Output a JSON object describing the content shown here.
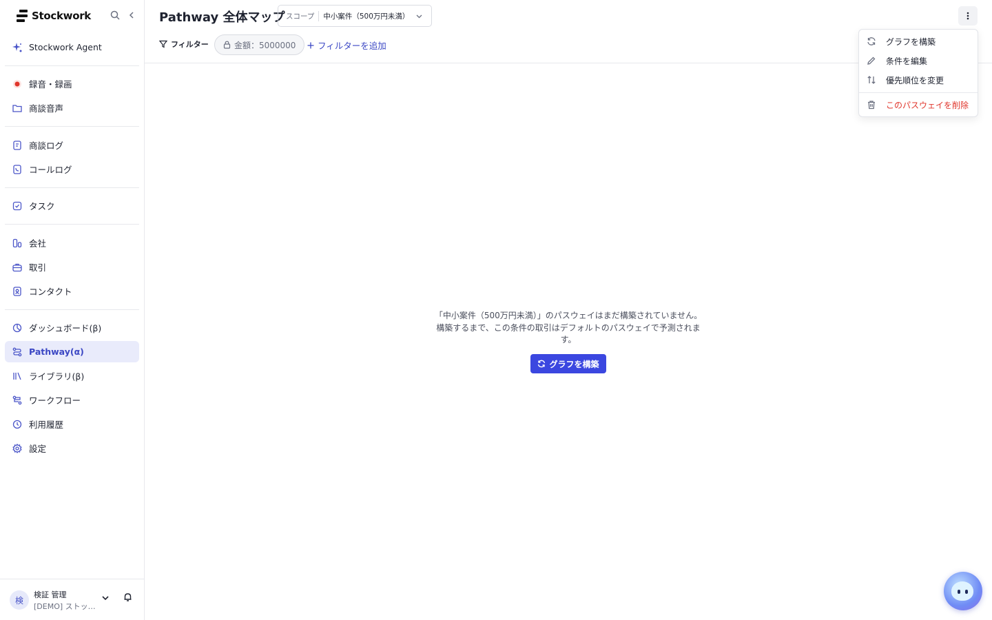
{
  "brand": {
    "name": "Stockwork"
  },
  "sidebar": {
    "agent": {
      "label": "Stockwork Agent",
      "icon": "sparkle-icon"
    },
    "groups": [
      [
        {
          "label": "録音・録画",
          "icon": "record-icon"
        },
        {
          "label": "商談音声",
          "icon": "folder-icon"
        }
      ],
      [
        {
          "label": "商談ログ",
          "icon": "document-icon"
        },
        {
          "label": "コールログ",
          "icon": "phone-icon"
        }
      ],
      [
        {
          "label": "タスク",
          "icon": "checkbox-icon"
        }
      ],
      [
        {
          "label": "会社",
          "icon": "building-icon"
        },
        {
          "label": "取引",
          "icon": "briefcase-icon"
        },
        {
          "label": "コンタクト",
          "icon": "contact-icon"
        }
      ],
      [
        {
          "label": "ダッシュボード(β)",
          "icon": "chart-icon"
        },
        {
          "label": "Pathway(α)",
          "icon": "pathway-icon",
          "active": true
        },
        {
          "label": "ライブラリ(β)",
          "icon": "library-icon"
        },
        {
          "label": "ワークフロー",
          "icon": "workflow-icon"
        },
        {
          "label": "利用履歴",
          "icon": "clock-icon"
        },
        {
          "label": "設定",
          "icon": "gear-icon"
        }
      ]
    ],
    "user": {
      "avatar": "検",
      "name": "検証 管理",
      "org": "[DEMO] ストックワーク株式会社"
    }
  },
  "header": {
    "title": "Pathway 全体マップ",
    "scope_label": "スコープ",
    "scope_value": "中小案件（500万円未満）",
    "filter_label": "フィルター",
    "chip_label": "金額：5000000",
    "add_filter": "フィルターを追加"
  },
  "empty_state": {
    "message": "「中小案件（500万円未満）」のパスウェイはまだ構築されていません。 構築するまで、この条件の取引はデフォルトのパスウェイで予測されます。",
    "button": "グラフを構築"
  },
  "menu": {
    "items": [
      {
        "label": "グラフを構築",
        "icon": "refresh-icon"
      },
      {
        "label": "条件を編集",
        "icon": "pencil-icon"
      },
      {
        "label": "優先順位を変更",
        "icon": "sort-icon"
      },
      {
        "label": "このパスウェイを削除",
        "icon": "trash-icon",
        "danger": true
      }
    ]
  },
  "colors": {
    "accent": "#3b47e0",
    "danger": "#e0352b",
    "active_bg": "#e9ebfb"
  }
}
